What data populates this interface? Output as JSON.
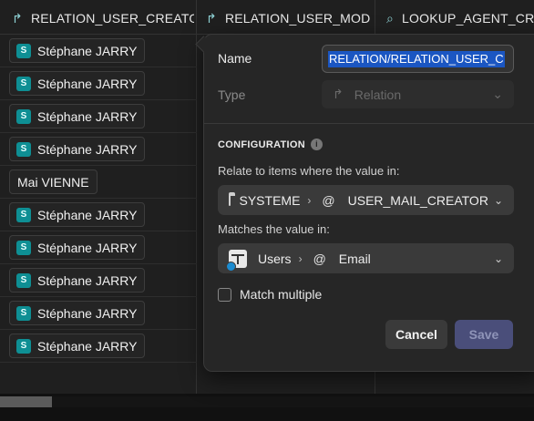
{
  "columns": [
    {
      "title": "RELATION_USER_CREATOR"
    },
    {
      "title": "RELATION_USER_MODIF"
    },
    {
      "title": "LOOKUP_AGENT_CREA"
    }
  ],
  "rows": [
    {
      "avatar": "S",
      "name": "Stéphane JARRY"
    },
    {
      "avatar": "S",
      "name": "Stéphane JARRY"
    },
    {
      "avatar": "S",
      "name": "Stéphane JARRY"
    },
    {
      "avatar": "S",
      "name": "Stéphane JARRY"
    },
    {
      "avatar": "",
      "name": "Mai VIENNE"
    },
    {
      "avatar": "S",
      "name": "Stéphane JARRY"
    },
    {
      "avatar": "S",
      "name": "Stéphane JARRY"
    },
    {
      "avatar": "S",
      "name": "Stéphane JARRY"
    },
    {
      "avatar": "S",
      "name": "Stéphane JARRY"
    },
    {
      "avatar": "S",
      "name": "Stéphane JARRY"
    }
  ],
  "popover": {
    "name_label": "Name",
    "name_value": "RELATION/RELATION_USER_C",
    "type_label": "Type",
    "type_value": "Relation",
    "section_title": "CONFIGURATION",
    "relate_label": "Relate to items where the value in:",
    "relate_table": "SYSTEME",
    "relate_field": "USER_MAIL_CREATOR",
    "matches_label": "Matches the value in:",
    "matches_table": "Users",
    "matches_field": "Email",
    "match_multiple_label": "Match multiple",
    "cancel_label": "Cancel",
    "save_label": "Save"
  },
  "colors": {
    "accent": "#0e8f94",
    "selection": "#1b56c2",
    "save_disabled": "#4a4e7a"
  }
}
